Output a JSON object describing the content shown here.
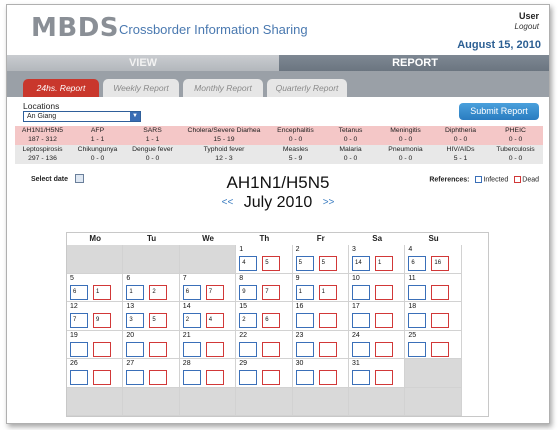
{
  "app": {
    "logo": "MBDS",
    "subtitle": "Crossborder Information Sharing",
    "user": "User",
    "logout": "Logout",
    "date": "August 15, 2010"
  },
  "nav": {
    "view": "VIEW",
    "report": "REPORT"
  },
  "tabs": [
    {
      "label": "24hs. Report",
      "active": true
    },
    {
      "label": "Weekly Report",
      "active": false
    },
    {
      "label": "Monthly Report",
      "active": false
    },
    {
      "label": "Quarterly Report",
      "active": false
    }
  ],
  "locations": {
    "label": "Locations",
    "selected": "An Giang"
  },
  "submit_label": "Submit Report",
  "diseases_row1": [
    {
      "name": "AH1N1/H5N5",
      "value": "187 - 312"
    },
    {
      "name": "AFP",
      "value": "1 - 1"
    },
    {
      "name": "SARS",
      "value": "1 - 1"
    },
    {
      "name": "Cholera/Severe Diarhea",
      "value": "15 - 19"
    },
    {
      "name": "Encephalitis",
      "value": "0 - 0"
    },
    {
      "name": "Tetanus",
      "value": "0 - 0"
    },
    {
      "name": "Meningitis",
      "value": "0 - 0"
    },
    {
      "name": "Diphtheria",
      "value": "0 - 0"
    },
    {
      "name": "PHEIC",
      "value": "0 - 0"
    }
  ],
  "diseases_row2": [
    {
      "name": "Leptospirosis",
      "value": "297 - 136"
    },
    {
      "name": "Chikungunya",
      "value": "0 - 0"
    },
    {
      "name": "Dengue fever",
      "value": "0 - 0"
    },
    {
      "name": "Typhoid fever",
      "value": "12 - 3"
    },
    {
      "name": "Measles",
      "value": "5 - 9"
    },
    {
      "name": "Malaria",
      "value": "0 - 0"
    },
    {
      "name": "Pneumonia",
      "value": "0 - 0"
    },
    {
      "name": "HIV/AIDs",
      "value": "5 - 1"
    },
    {
      "name": "Tuberculosis",
      "value": "0 - 0"
    }
  ],
  "select_date_label": "Select date",
  "references": {
    "label": "References:",
    "infected": "Infected",
    "dead": "Dead",
    "infected_color": "#3a6fb8",
    "dead_color": "#d13838"
  },
  "disease_title": "AH1N1/H5N5",
  "month_label": "July 2010",
  "prev_icon": "<<",
  "next_icon": ">>",
  "weekdays": [
    "Mo",
    "Tu",
    "We",
    "Th",
    "Fr",
    "Sa",
    "Su"
  ],
  "calendar": [
    {
      "day": 1,
      "infected": "4",
      "dead": "5"
    },
    {
      "day": 2,
      "infected": "5",
      "dead": "5"
    },
    {
      "day": 3,
      "infected": "14",
      "dead": "1"
    },
    {
      "day": 4,
      "infected": "6",
      "dead": "16"
    },
    {
      "day": 5,
      "infected": "6",
      "dead": "1"
    },
    {
      "day": 6,
      "infected": "1",
      "dead": "2"
    },
    {
      "day": 7,
      "infected": "6",
      "dead": "7"
    },
    {
      "day": 8,
      "infected": "9",
      "dead": "7"
    },
    {
      "day": 9,
      "infected": "1",
      "dead": "1"
    },
    {
      "day": 10,
      "infected": "",
      "dead": ""
    },
    {
      "day": 11,
      "infected": "",
      "dead": ""
    },
    {
      "day": 12,
      "infected": "7",
      "dead": "9"
    },
    {
      "day": 13,
      "infected": "3",
      "dead": "5"
    },
    {
      "day": 14,
      "infected": "2",
      "dead": "4"
    },
    {
      "day": 15,
      "infected": "2",
      "dead": "6"
    },
    {
      "day": 16,
      "infected": "",
      "dead": ""
    },
    {
      "day": 17,
      "infected": "",
      "dead": ""
    },
    {
      "day": 18,
      "infected": "",
      "dead": ""
    },
    {
      "day": 19,
      "infected": "",
      "dead": ""
    },
    {
      "day": 20,
      "infected": "",
      "dead": ""
    },
    {
      "day": 21,
      "infected": "",
      "dead": ""
    },
    {
      "day": 22,
      "infected": "",
      "dead": ""
    },
    {
      "day": 23,
      "infected": "",
      "dead": ""
    },
    {
      "day": 24,
      "infected": "",
      "dead": ""
    },
    {
      "day": 25,
      "infected": "",
      "dead": ""
    },
    {
      "day": 26,
      "infected": "",
      "dead": ""
    },
    {
      "day": 27,
      "infected": "",
      "dead": ""
    },
    {
      "day": 28,
      "infected": "",
      "dead": ""
    },
    {
      "day": 29,
      "infected": "",
      "dead": ""
    },
    {
      "day": 30,
      "infected": "",
      "dead": ""
    },
    {
      "day": 31,
      "infected": "",
      "dead": ""
    }
  ]
}
